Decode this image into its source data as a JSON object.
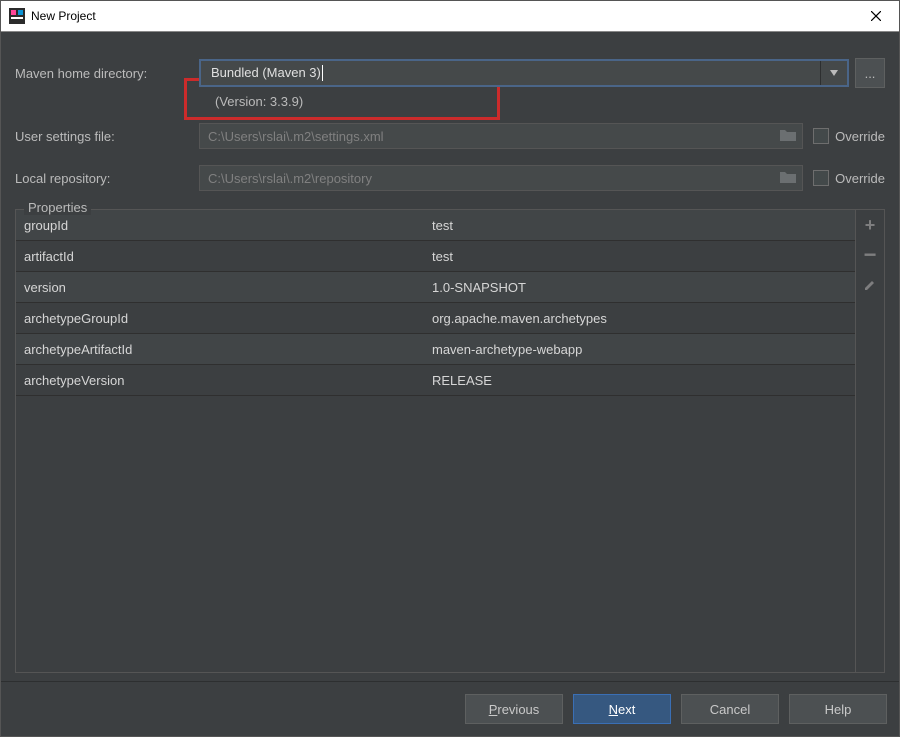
{
  "window": {
    "title": "New Project"
  },
  "maven": {
    "home_label": "Maven home directory:",
    "home_value": "Bundled (Maven 3)",
    "version_text": "(Version: 3.3.9)",
    "user_settings_label": "User settings file:",
    "user_settings_value": "C:\\Users\\rslai\\.m2\\settings.xml",
    "local_repo_label": "Local repository:",
    "local_repo_value": "C:\\Users\\rslai\\.m2\\repository",
    "override_label": "Override"
  },
  "properties": {
    "title": "Properties",
    "rows": [
      {
        "key": "groupId",
        "value": "test"
      },
      {
        "key": "artifactId",
        "value": "test"
      },
      {
        "key": "version",
        "value": "1.0-SNAPSHOT"
      },
      {
        "key": "archetypeGroupId",
        "value": "org.apache.maven.archetypes"
      },
      {
        "key": "archetypeArtifactId",
        "value": "maven-archetype-webapp"
      },
      {
        "key": "archetypeVersion",
        "value": "RELEASE"
      }
    ]
  },
  "buttons": {
    "previous_p": "P",
    "previous_rest": "revious",
    "next_n": "N",
    "next_rest": "ext",
    "cancel": "Cancel",
    "help": "Help"
  }
}
